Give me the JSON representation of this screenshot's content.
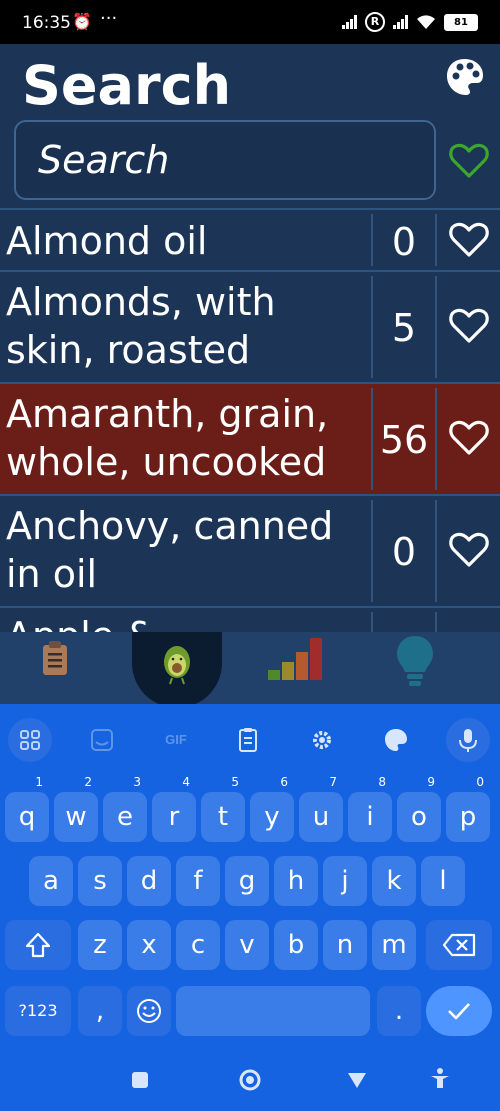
{
  "status": {
    "time": "16:35",
    "alarm_icon": "alarm-icon",
    "battery": "81",
    "r_label": "R"
  },
  "header": {
    "title": "Search"
  },
  "search": {
    "placeholder": "Search"
  },
  "foods": [
    {
      "name": "Almond oil",
      "score": "0",
      "highlight": false
    },
    {
      "name": "Almonds, with skin, roasted",
      "score": "5",
      "highlight": false
    },
    {
      "name": "Amaranth, grain, whole, uncooked",
      "score": "56",
      "highlight": true
    },
    {
      "name": "Anchovy, canned in oil",
      "score": "0",
      "highlight": false
    },
    {
      "name": "Apple &",
      "score": "",
      "highlight": false
    }
  ],
  "colors": {
    "app_bg": "#1c3557",
    "highlight": "#6b1e17",
    "favorite_green": "#3ba82b",
    "keyboard": "#1563e0"
  },
  "keyboard": {
    "tools": [
      "apps-icon",
      "sticker-icon",
      "GIF",
      "clipboard-icon",
      "gear-icon",
      "palette-icon",
      "mic-icon"
    ],
    "gif_label": "GIF",
    "row1": [
      "q",
      "w",
      "e",
      "r",
      "t",
      "y",
      "u",
      "i",
      "o",
      "p"
    ],
    "row1_hints": [
      "1",
      "2",
      "3",
      "4",
      "5",
      "6",
      "7",
      "8",
      "9",
      "0"
    ],
    "row2": [
      "a",
      "s",
      "d",
      "f",
      "g",
      "h",
      "j",
      "k",
      "l"
    ],
    "row3": [
      "z",
      "x",
      "c",
      "v",
      "b",
      "n",
      "m"
    ],
    "symbols": "?123",
    "comma": ",",
    "period": "."
  }
}
